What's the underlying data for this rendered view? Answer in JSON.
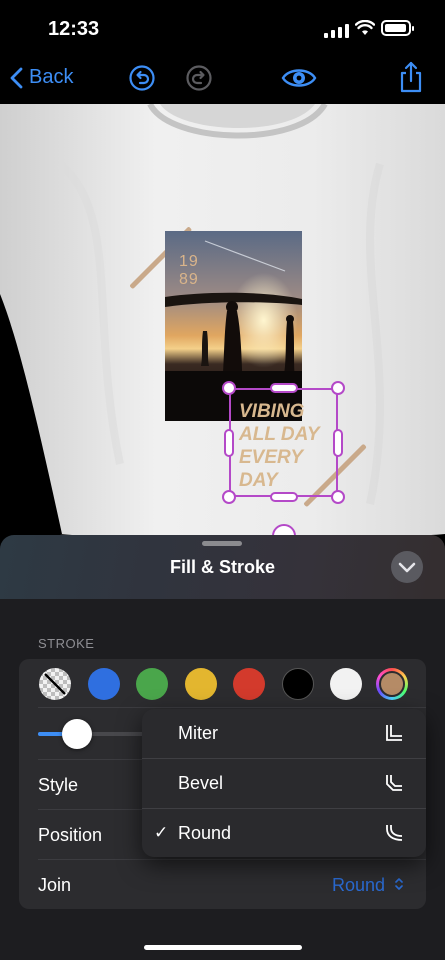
{
  "status_bar": {
    "time": "12:33"
  },
  "nav": {
    "back_label": "Back"
  },
  "canvas": {
    "photo_text": [
      "19",
      "89"
    ],
    "vibe_text": [
      "VIBING",
      "ALL DAY",
      "EVERY",
      "DAY"
    ]
  },
  "sheet": {
    "title": "Fill & Stroke",
    "section_label": "STROKE",
    "swatches": [
      {
        "name": "none",
        "color": "transparent"
      },
      {
        "name": "blue",
        "color": "#2f6fe0"
      },
      {
        "name": "green",
        "color": "#4aa64b"
      },
      {
        "name": "yellow",
        "color": "#e3b62f"
      },
      {
        "name": "red",
        "color": "#d33a2c"
      },
      {
        "name": "black",
        "color": "#000000"
      },
      {
        "name": "white",
        "color": "#f2f2f2"
      },
      {
        "name": "custom",
        "color": "#b58b66"
      }
    ],
    "stroke_width_fraction": 0.22,
    "rows": {
      "style": "Style",
      "position": "Position",
      "join": "Join",
      "join_value": "Round"
    }
  },
  "join_menu": {
    "options": [
      "Miter",
      "Bevel",
      "Round"
    ],
    "selected": "Round",
    "check": "✓"
  },
  "colors": {
    "accent": "#3d8ef5",
    "selection": "#b449c8"
  }
}
